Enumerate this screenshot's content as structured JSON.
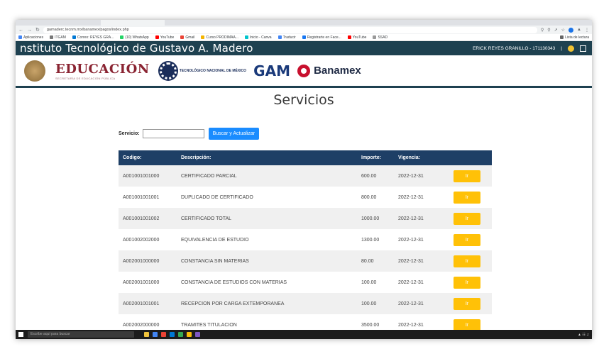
{
  "browser": {
    "url": "gamaderc.tecnm.mx/banamex/pagos/index.php",
    "bookmarks": [
      "Aplicaciones",
      "ITGAM",
      "Correo: REYES GRA...",
      "(10) WhatsApp",
      "YouTube",
      "Gmail",
      "Curso PRODIMAA...",
      "Inicio - Canva",
      "Traducir",
      "Registrarte en Face...",
      "YouTube",
      "SSAD"
    ],
    "reading_list": "Lista de lectura"
  },
  "header": {
    "title": "nstituto Tecnológico de Gustavo A. Madero",
    "user": "ERICK REYES GRANILLO - 171130343",
    "separator": "|"
  },
  "logos": {
    "educacion": "EDUCACIÓN",
    "educacion_sub": "SECRETARÍA DE EDUCACIÓN PÚBLICA",
    "tecnm": "TECNOLÓGICO NACIONAL DE MÉXICO",
    "gam": "GAM",
    "banamex": "Banamex"
  },
  "main": {
    "title": "Servicios",
    "search_label": "Servicio:",
    "search_value": "",
    "search_button": "Buscar y Actualizar"
  },
  "table": {
    "headers": [
      "Codigo:",
      "Descripción:",
      "Importe:",
      "Vigencia:"
    ],
    "rows": [
      {
        "code": "A001001001000",
        "desc": "CERTIFICADO PARCIAL",
        "amount": "600.00",
        "valid": "2022-12-31",
        "action": "Ir"
      },
      {
        "code": "A001001001001",
        "desc": "DUPLICADO DE CERTIFICADO",
        "amount": "800.00",
        "valid": "2022-12-31",
        "action": "Ir"
      },
      {
        "code": "A001001001002",
        "desc": "CERTIFICADO TOTAL",
        "amount": "1000.00",
        "valid": "2022-12-31",
        "action": "Ir"
      },
      {
        "code": "A001002002000",
        "desc": "EQUIVALENCIA DE ESTUDIO",
        "amount": "1300.00",
        "valid": "2022-12-31",
        "action": "Ir"
      },
      {
        "code": "A002001000000",
        "desc": "CONSTANCIA SIN MATERIAS",
        "amount": "80.00",
        "valid": "2022-12-31",
        "action": "Ir"
      },
      {
        "code": "A002001001000",
        "desc": "CONSTANCIA DE ESTUDIOS CON MATERIAS",
        "amount": "100.00",
        "valid": "2022-12-31",
        "action": "Ir"
      },
      {
        "code": "A002001001001",
        "desc": "RECEPCION POR CARGA EXTEMPORANEA",
        "amount": "100.00",
        "valid": "2022-12-31",
        "action": "Ir"
      },
      {
        "code": "A002002000000",
        "desc": "TRAMITES TITULACION",
        "amount": "3500.00",
        "valid": "2022-12-31",
        "action": "Ir"
      }
    ]
  },
  "taskbar": {
    "search_placeholder": "Escribe aquí para buscar"
  },
  "colors": {
    "header_bg": "#1e4150",
    "table_header_bg": "#1e3f66",
    "button_blue": "#1a8cff",
    "button_yellow": "#ffc107"
  }
}
